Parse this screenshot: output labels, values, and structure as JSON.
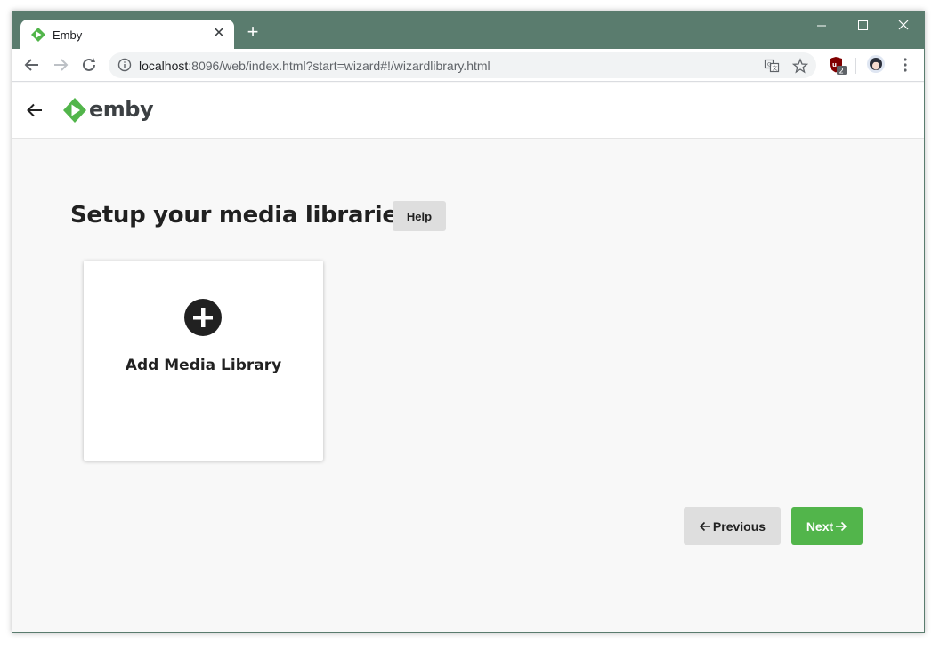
{
  "browser": {
    "tab_title": "Emby",
    "url_host": "localhost",
    "url_rest": ":8096/web/index.html?start=wizard#!/wizardlibrary.html",
    "extension_badge": "2"
  },
  "app": {
    "logo_text": "emby",
    "brand_color": "#52b54b"
  },
  "main": {
    "title": "Setup your media libraries",
    "help_label": "Help",
    "add_library_label": "Add Media Library",
    "previous_label": "Previous",
    "next_label": "Next"
  },
  "icons": {
    "tab_favicon": "emby-favicon-icon",
    "back": "arrow-left-icon",
    "add": "plus-circle-icon"
  }
}
